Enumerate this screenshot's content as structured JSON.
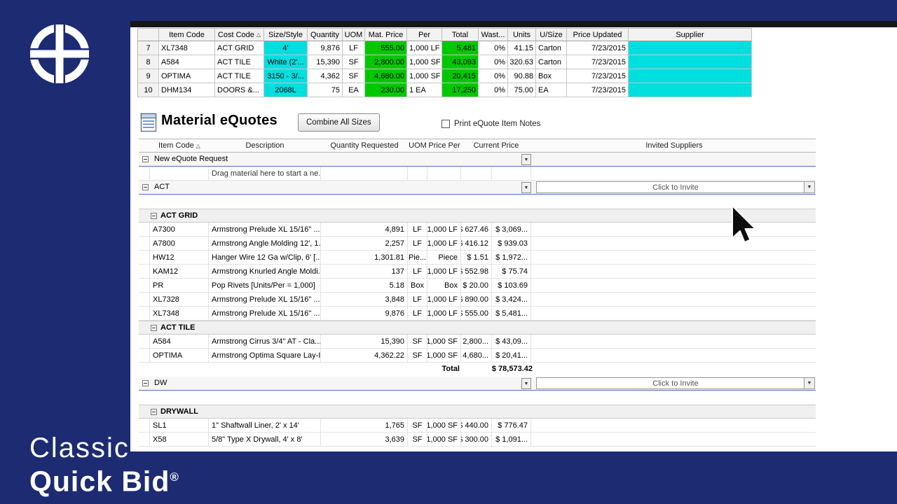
{
  "brand": {
    "line1": "Classic",
    "line2": "Quick Bid",
    "registered": "®"
  },
  "colors": {
    "navy": "#1c2b72",
    "cyan": "#00dfdf",
    "green": "#00c800",
    "group_line": "#4a72b8"
  },
  "app": {
    "top_table": {
      "columns": [
        {
          "label": ""
        },
        {
          "label": "Item Code"
        },
        {
          "label": "Cost Code",
          "sort": true
        },
        {
          "label": "Size/Style"
        },
        {
          "label": "Quantity"
        },
        {
          "label": "UOM"
        },
        {
          "label": "Mat. Price"
        },
        {
          "label": "Per"
        },
        {
          "label": "Total"
        },
        {
          "label": "Wast..."
        },
        {
          "label": "Units"
        },
        {
          "label": "U/Size"
        },
        {
          "label": "Price Updated"
        },
        {
          "label": "Supplier"
        }
      ],
      "rows": [
        [
          "7",
          "XL7348",
          "ACT GRID",
          "4'",
          "9,876",
          "LF",
          "555.00",
          "1,000 LF",
          "5,481",
          "0%",
          "41.15",
          "Carton",
          "7/23/2015",
          ""
        ],
        [
          "8",
          "A584",
          "ACT TILE",
          "White (2'...",
          "15,390",
          "SF",
          "2,800.00",
          "1,000 SF",
          "43,093",
          "0%",
          "320.63",
          "Carton",
          "7/23/2015",
          ""
        ],
        [
          "9",
          "OPTIMA",
          "ACT TILE",
          "3150 - 3/...",
          "4,362",
          "SF",
          "4,680.00",
          "1,000 SF",
          "20,415",
          "0%",
          "90.88",
          "Box",
          "7/23/2015",
          ""
        ],
        [
          "10",
          "DHM134",
          "DOORS &...",
          "2068L",
          "75",
          "EA",
          "230.00",
          "1 EA",
          "17,250",
          "0%",
          "75.00",
          "EA",
          "7/23/2015",
          ""
        ]
      ]
    },
    "equotes": {
      "title": "Material eQuotes",
      "combine_button": "Combine All Sizes",
      "print_checkbox_label": "Print eQuote Item Notes",
      "print_checkbox_checked": false,
      "columns": [
        {
          "label": "Item Code",
          "sort": true
        },
        {
          "label": "Description"
        },
        {
          "label": "Quantity Requested"
        },
        {
          "label": "UOM"
        },
        {
          "label": "Price Per"
        },
        {
          "label": "Current Price"
        },
        {
          "label": "Invited Suppliers"
        }
      ],
      "rows": [
        {
          "type": "group",
          "label": "New eQuote Request"
        },
        {
          "type": "hint",
          "text": "Drag material here to start a ne..."
        },
        {
          "type": "group",
          "label": "ACT",
          "invite": "Click to Invite"
        },
        {
          "type": "gap"
        },
        {
          "type": "subheader",
          "label": "ACT GRID"
        },
        {
          "type": "item",
          "code": "A7300",
          "desc": "Armstrong Prelude XL 15/16\" ...",
          "qty": "4,891",
          "uom": "LF",
          "per": "1,000 LF",
          "price": "$ 627.46",
          "ext": "$ 3,069..."
        },
        {
          "type": "item",
          "code": "A7800",
          "desc": "Armstrong Angle Molding 12', 1...",
          "qty": "2,257",
          "uom": "LF",
          "per": "1,000 LF",
          "price": "$ 416.12",
          "ext": "$ 939.03"
        },
        {
          "type": "item",
          "code": "HW12",
          "desc": "Hanger Wire 12 Ga w/Clip, 6' [...",
          "qty": "1,301.81",
          "uom": "Pie...",
          "per": "Piece",
          "price": "$ 1.51",
          "ext": "$ 1,972..."
        },
        {
          "type": "item",
          "code": "KAM12",
          "desc": "Armstrong Knurled Angle Moldi...",
          "qty": "137",
          "uom": "LF",
          "per": "1,000 LF",
          "price": "$ 552.98",
          "ext": "$ 75.74"
        },
        {
          "type": "item",
          "code": "PR",
          "desc": "Pop Rivets [Units/Per = 1,000]",
          "qty": "5.18",
          "uom": "Box",
          "per": "Box",
          "price": "$ 20.00",
          "ext": "$ 103.69"
        },
        {
          "type": "item",
          "code": "XL7328",
          "desc": "Armstrong Prelude XL 15/16\" ...",
          "qty": "3,848",
          "uom": "LF",
          "per": "1,000 LF",
          "price": "$ 890.00",
          "ext": "$ 3,424..."
        },
        {
          "type": "item",
          "code": "XL7348",
          "desc": "Armstrong Prelude XL 15/16\" ...",
          "qty": "9,876",
          "uom": "LF",
          "per": "1,000 LF",
          "price": "$ 555.00",
          "ext": "$ 5,481..."
        },
        {
          "type": "subheader",
          "label": "ACT TILE"
        },
        {
          "type": "item",
          "code": "A584",
          "desc": "Armstrong Cirrus 3/4\" AT - Cla...",
          "qty": "15,390",
          "uom": "SF",
          "per": "1,000 SF",
          "price": "$ 2,800...",
          "ext": "$ 43,09..."
        },
        {
          "type": "item",
          "code": "OPTIMA",
          "desc": "Armstrong Optima Square Lay-I...",
          "qty": "4,362.22",
          "uom": "SF",
          "per": "1,000 SF",
          "price": "$ 4,680...",
          "ext": "$ 20,41..."
        },
        {
          "type": "total",
          "label": "Total",
          "value": "$ 78,573.42"
        },
        {
          "type": "group",
          "label": "DW",
          "invite": "Click to Invite"
        },
        {
          "type": "gap"
        },
        {
          "type": "subheader",
          "label": "DRYWALL"
        },
        {
          "type": "item",
          "code": "SL1",
          "desc": "1\" Shaftwall Liner, 2' x 14'",
          "qty": "1,765",
          "uom": "SF",
          "per": "1,000 SF",
          "price": "$ 440.00",
          "ext": "$ 776.47"
        },
        {
          "type": "item",
          "code": "X58",
          "desc": "5/8\" Type X Drywall, 4' x 8'",
          "qty": "3,639",
          "uom": "SF",
          "per": "1,000 SF",
          "price": "$ 300.00",
          "ext": "$ 1,091..."
        }
      ]
    }
  }
}
